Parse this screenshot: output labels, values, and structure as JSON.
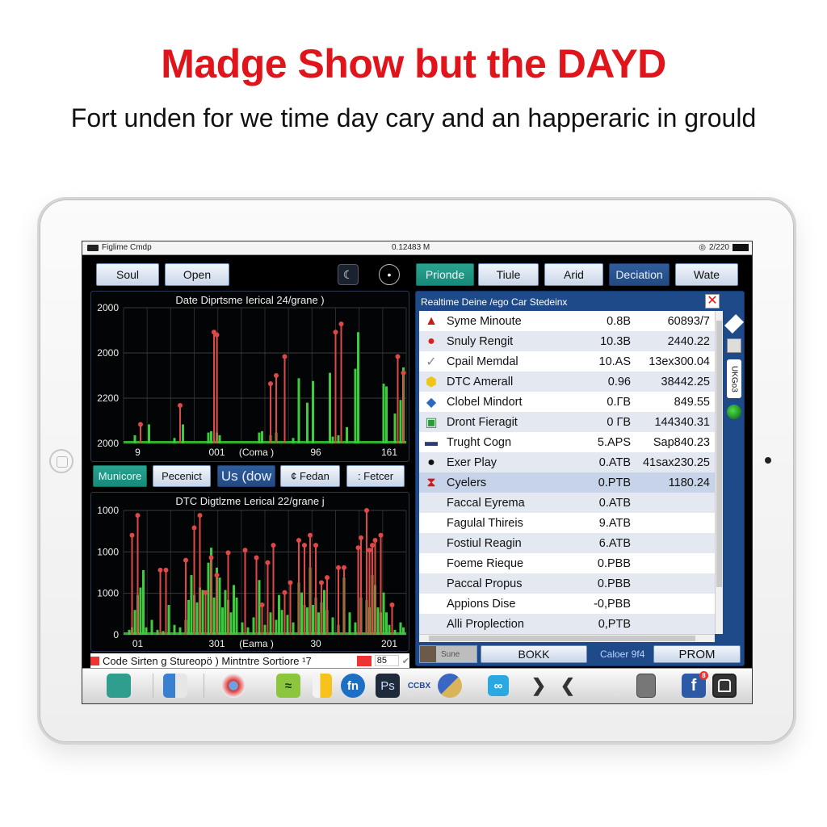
{
  "headline": "Madge Show but the DAYD",
  "subheadline": "Fort unden for we time day cary and an happeraric in grould",
  "colors": {
    "headline": "#e0141b",
    "teal_button": "#1f9684",
    "blue_button": "#2a5592",
    "panel_blue": "#1e4a8a",
    "spike_red": "#e04848",
    "trace_green": "#3ecb3e"
  },
  "status_bar": {
    "app_name": "Figlime Cmdp",
    "time": "0.12483 M",
    "right_text": "2/220",
    "icons": [
      "app-icon",
      "signal-icon",
      "battery-icon"
    ]
  },
  "toolbar_left": {
    "buttons": [
      {
        "label": "Soul"
      },
      {
        "label": "Open"
      }
    ],
    "icons": [
      "moon-icon",
      "microphone-icon"
    ]
  },
  "toolbar_right": {
    "buttons": [
      {
        "label": "Prionde",
        "style": "teal"
      },
      {
        "label": "Tiule",
        "style": "light"
      },
      {
        "label": "Arid",
        "style": "light"
      },
      {
        "label": "Deciation",
        "style": "blue"
      },
      {
        "label": "Wate",
        "style": "light"
      }
    ]
  },
  "mid_buttons": [
    {
      "label": "Municore",
      "style": "teal"
    },
    {
      "label": "Pecenict",
      "style": "light"
    },
    {
      "label": "Us (dow",
      "style": "blue"
    },
    {
      "label": "¢ Fedan",
      "style": "light"
    },
    {
      "label": ": Fetcer",
      "style": "light"
    }
  ],
  "chart_data": [
    {
      "type": "bar",
      "title": "Date Diprtsme Ierical 24/grane )",
      "xlabel": "",
      "ylabel": "",
      "y_tick_labels": [
        "2000",
        "2000",
        "2200",
        "2000"
      ],
      "x_tick_labels": [
        "9",
        "001",
        "(Coma )",
        "96",
        "161"
      ],
      "grid": true,
      "ylim": [
        0,
        100
      ],
      "x_range": [
        0,
        100
      ],
      "series": [
        {
          "name": "baseline",
          "color": "#3ecb3e",
          "x": [
            4,
            9,
            18,
            21,
            30,
            31,
            33,
            34,
            48,
            49,
            52,
            54,
            60,
            62,
            65,
            67,
            73,
            74,
            76,
            79,
            82,
            83,
            92,
            93,
            96,
            98,
            99
          ],
          "values": [
            6,
            14,
            4,
            14,
            8,
            9,
            8,
            6,
            8,
            9,
            6,
            8,
            4,
            48,
            30,
            46,
            52,
            5,
            6,
            12,
            55,
            82,
            44,
            42,
            22,
            32,
            56
          ]
        },
        {
          "name": "spikes",
          "color": "#e04848",
          "x": [
            6,
            20,
            32,
            33,
            52,
            54,
            57,
            75,
            77,
            97,
            99
          ],
          "values": [
            14,
            28,
            82,
            80,
            44,
            50,
            64,
            82,
            88,
            64,
            52
          ]
        }
      ]
    },
    {
      "type": "bar",
      "title": "DTC Digtlzme Lerical 22/grane j",
      "xlabel": "",
      "ylabel": "",
      "y_tick_labels": [
        "1000",
        "1000",
        "1000",
        "0"
      ],
      "x_tick_labels": [
        "01",
        "301",
        "(Eama )",
        "30",
        "201"
      ],
      "grid": true,
      "ylim": [
        0,
        100
      ],
      "x_range": [
        0,
        100
      ],
      "series": [
        {
          "name": "green",
          "color": "#3ecb3e",
          "x": [
            2,
            3,
            4,
            5,
            6,
            7,
            8,
            10,
            12,
            14,
            16,
            18,
            20,
            22,
            23,
            24,
            25,
            26,
            27,
            28,
            30,
            31,
            32,
            33,
            34,
            35,
            36,
            37,
            38,
            39,
            40,
            42,
            44,
            46,
            48,
            50,
            52,
            54,
            55,
            56,
            58,
            60,
            62,
            63,
            64,
            65,
            66,
            67,
            68,
            69,
            70,
            71,
            72,
            74,
            76,
            78,
            80,
            82,
            84,
            86,
            87,
            88,
            89,
            90,
            91,
            92,
            93,
            94,
            96,
            98,
            99
          ],
          "values": [
            4,
            6,
            20,
            32,
            38,
            52,
            6,
            12,
            4,
            3,
            24,
            8,
            6,
            12,
            28,
            48,
            32,
            26,
            38,
            36,
            58,
            70,
            30,
            54,
            46,
            22,
            36,
            28,
            18,
            40,
            30,
            10,
            6,
            14,
            44,
            8,
            18,
            12,
            32,
            20,
            16,
            10,
            42,
            34,
            24,
            22,
            54,
            24,
            30,
            18,
            26,
            36,
            20,
            14,
            8,
            46,
            18,
            10,
            30,
            28,
            22,
            48,
            40,
            22,
            18,
            34,
            18,
            8,
            4,
            10,
            6
          ]
        },
        {
          "name": "red",
          "color": "#e04848",
          "x": [
            3,
            5,
            13,
            15,
            22,
            25,
            27,
            29,
            31,
            33,
            37,
            43,
            47,
            49,
            51,
            53,
            57,
            59,
            62,
            64,
            66,
            68,
            70,
            72,
            76,
            78,
            83,
            84,
            86,
            87,
            88,
            89,
            91,
            95
          ],
          "values": [
            80,
            96,
            52,
            52,
            60,
            86,
            96,
            34,
            62,
            48,
            66,
            68,
            62,
            24,
            58,
            72,
            34,
            42,
            76,
            72,
            80,
            72,
            42,
            46,
            54,
            54,
            70,
            78,
            100,
            68,
            72,
            76,
            80,
            24
          ]
        }
      ]
    }
  ],
  "legend_bar": {
    "text": "Code Sirten g Stureopö ) Mintntre Sortiore ¹7",
    "value": "85"
  },
  "right_panel": {
    "title": "Realtime Deine /ego Car Stedeinx",
    "rows": [
      {
        "icon": "warning-triangle-icon",
        "name": "Syme Minoute",
        "size": "0.8B",
        "value": "60893/7"
      },
      {
        "icon": "red-circle-icon",
        "name": "Snuly Rengit",
        "size": "10.3B",
        "value": "2440.22"
      },
      {
        "icon": "check-icon",
        "name": "Cpail Memdal",
        "size": "10.AS",
        "value": "13ex300.04"
      },
      {
        "icon": "yellow-hexagon-icon",
        "name": "DTC Amerall",
        "size": "0.96",
        "value": "38442.25"
      },
      {
        "icon": "box-icon",
        "name": "Clobel Mindort",
        "size": "0.ГB",
        "value": "849.55"
      },
      {
        "icon": "money-icon",
        "name": "Dront Fieragit",
        "size": "0 ГB",
        "value": "144340.31"
      },
      {
        "icon": "monitor-icon",
        "name": "Trught Cogn",
        "size": "5.APS",
        "value": "Sap840.23"
      },
      {
        "icon": "black-circle-icon",
        "name": "Exer Play",
        "size": "0.ATB",
        "value": "41sax230.25"
      },
      {
        "icon": "goblet-icon",
        "name": "Cyelers",
        "size": "0.PTB",
        "value": "1180.24",
        "selected": true
      },
      {
        "icon": "",
        "name": "Faccal Eyrema",
        "size": "0.ATB",
        "value": ""
      },
      {
        "icon": "",
        "name": "Fagulal Thireis",
        "size": "9.ATB",
        "value": ""
      },
      {
        "icon": "",
        "name": "Fostiul Reagin",
        "size": "6.ATB",
        "value": ""
      },
      {
        "icon": "",
        "name": "Foeme Rieque",
        "size": "0.PBB",
        "value": ""
      },
      {
        "icon": "",
        "name": "Paccal Propus",
        "size": "0.PBB",
        "value": ""
      },
      {
        "icon": "",
        "name": "Appions Dise",
        "size": "-0,PBB",
        "value": ""
      },
      {
        "icon": "",
        "name": "Alli Proplection",
        "size": "0,PTB",
        "value": ""
      }
    ],
    "side_tools": [
      "diamond-nav-icon",
      "image-icon",
      "vertical-tab",
      "globe-icon"
    ],
    "side_tab_label": "UKGo3",
    "footer": {
      "thumb_label": "Sune",
      "button_left": "BOKK",
      "mid_text": "Caloer 9f4",
      "button_right": "PROM"
    }
  },
  "dock": {
    "icons": [
      "folder-icon",
      "calendar-icon",
      "chrome-like-icon",
      "wifi-app-icon",
      "files-icon",
      "fn-app-icon",
      "photoshop-icon",
      "ccbx-icon",
      "globe-app-icon",
      "infinity-app-icon",
      "chevron-right-icon",
      "chevron-left-icon",
      "sd-card-icon",
      "facebook-icon",
      "bus-app-icon"
    ],
    "facebook_badge": "8",
    "ps_label": "Ps",
    "fn_label": "fn",
    "ccbx_label": "CCBX",
    "inf_label": "∞"
  }
}
